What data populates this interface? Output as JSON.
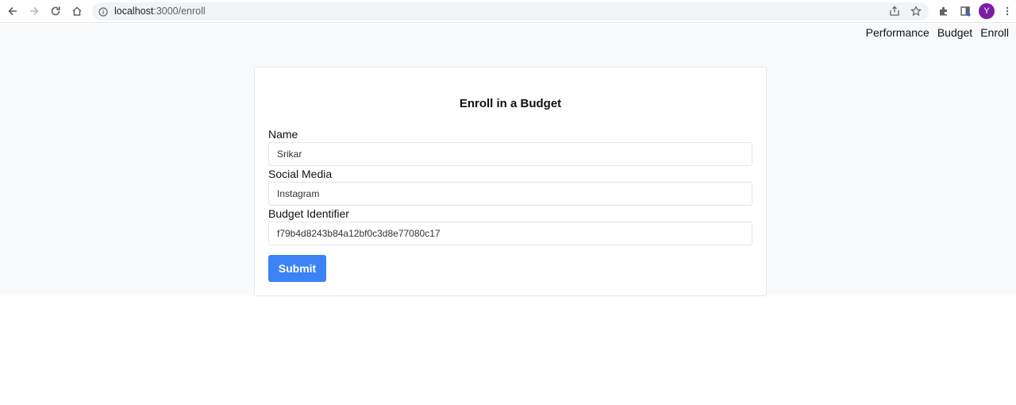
{
  "browser": {
    "url_host": "localhost",
    "url_path": ":3000/enroll",
    "profile_initial": "Y"
  },
  "nav": {
    "links": [
      "Performance",
      "Budget",
      "Enroll"
    ]
  },
  "form": {
    "title": "Enroll in a Budget",
    "fields": [
      {
        "label": "Name",
        "value": "Srikar"
      },
      {
        "label": "Social Media",
        "value": "Instagram"
      },
      {
        "label": "Budget Identifier",
        "value": "f79b4d8243b84a12bf0c3d8e77080c17"
      }
    ],
    "submit_label": "Submit"
  },
  "colors": {
    "accent": "#3b82f6",
    "avatar": "#7b1fa2",
    "page_bg": "#f8f9fb"
  }
}
